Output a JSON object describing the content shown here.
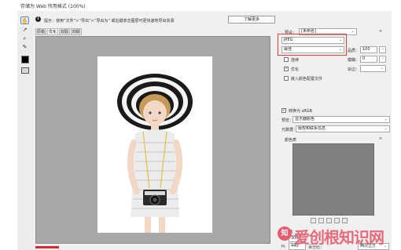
{
  "window": {
    "title": "存储为 Web 所用格式 (100%)"
  },
  "infobar": {
    "icon": "info-icon",
    "text": "提示：使用“文件”>“导出”>“导出为” 或右键单击图层可更快速地导出资源",
    "learn_button": "了解更多"
  },
  "tools": [
    {
      "name": "hand-tool-icon",
      "glyph": "✋"
    },
    {
      "name": "slice-select-tool-icon",
      "glyph": "↗"
    },
    {
      "name": "zoom-tool-icon",
      "glyph": "🔍"
    },
    {
      "name": "eyedropper-tool-icon",
      "glyph": "✎"
    }
  ],
  "tabs": [
    "原稿",
    "优化",
    "双联",
    "四联"
  ],
  "panel": {
    "preset_label": "预设：",
    "preset_value": "[未命名]",
    "format_value": "JPEG",
    "quality_preset": "最佳",
    "quality_label": "品质：",
    "quality_value": "100",
    "progressive_label": "连续",
    "blur_label": "模糊：",
    "blur_value": "0",
    "optimized_label": "优化",
    "matte_label": "杂边：",
    "embed_profile_label": "嵌入颜色配置文件",
    "convert_srgb_label": "转换为 sRGB",
    "preview_label": "预览：",
    "preview_value": "显示器颜色",
    "metadata_label": "元数据：",
    "metadata_value": "版权和联系信息",
    "color_table_label": "颜色表",
    "image_size_label": "图像大",
    "width_label": "W:",
    "width_value": "300",
    "height_label": "H:",
    "height_value": "440",
    "percent_label": "百分比：",
    "quality_mode": "两次立方"
  },
  "checkboxes": {
    "progressive": false,
    "optimized": true,
    "embed_profile": false,
    "convert_srgb": true
  },
  "watermark": {
    "text": "爱创根知识网"
  },
  "colors": {
    "highlight": "#e53935",
    "canvas_bg": "#a8a8a8",
    "color_table": "#808080",
    "watermark": "#e85b6d"
  }
}
